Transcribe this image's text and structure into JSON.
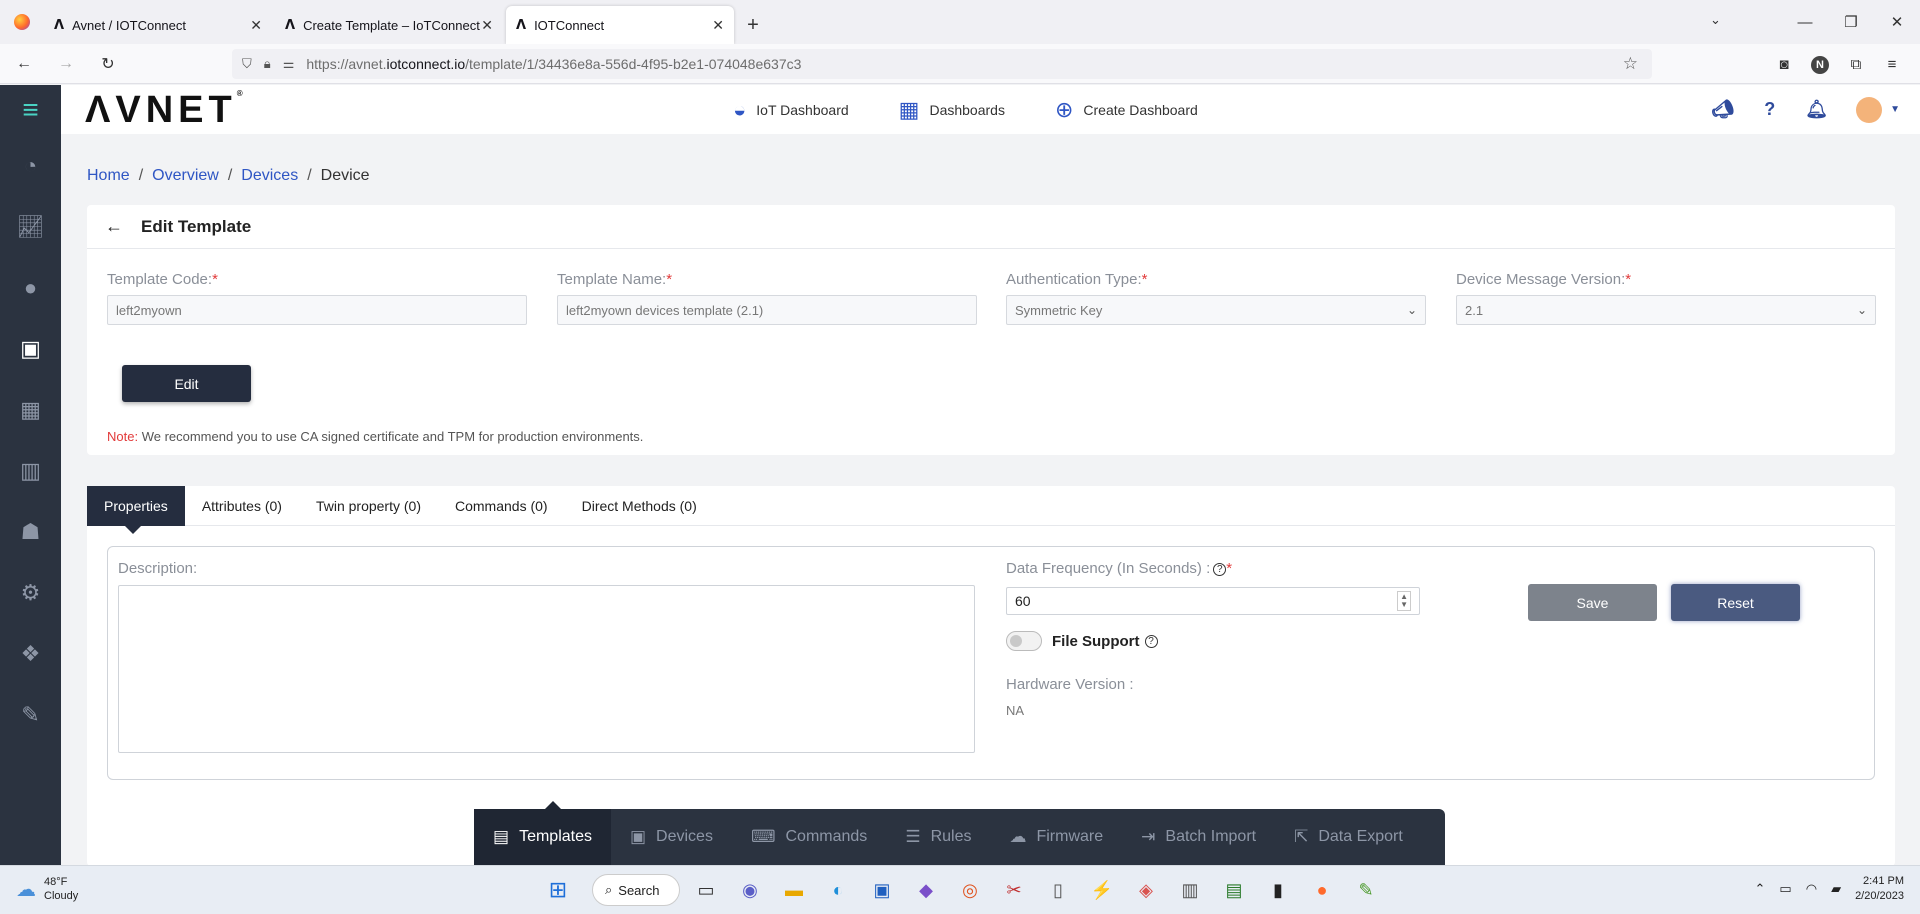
{
  "browser": {
    "tabs": [
      {
        "favicon": "Λ",
        "title": "Avnet / IOTConnect",
        "active": false
      },
      {
        "favicon": "Λ",
        "title": "Create Template – IoTConnect",
        "active": false
      },
      {
        "favicon": "Λ",
        "title": "IOTConnect",
        "active": true
      }
    ],
    "url_prefix": "https://avnet.",
    "url_domain": "iotconnect.io",
    "url_path": "/template/1/34436e8a-556d-4f95-b2e1-074048e637c3",
    "profile_initial": "N"
  },
  "header": {
    "logo": "ΛVNET",
    "logo_mark": "®",
    "nav": [
      {
        "label": "IoT Dashboard",
        "icon": "gauge-icon"
      },
      {
        "label": "Dashboards",
        "icon": "grid-icon"
      },
      {
        "label": "Create Dashboard",
        "icon": "plus-circle-icon"
      }
    ],
    "right_icons": [
      "megaphone-icon",
      "help-icon",
      "bell-icon",
      "avatar"
    ]
  },
  "breadcrumb": {
    "items": [
      "Home",
      "Overview",
      "Devices"
    ],
    "current": "Device",
    "separator": "/"
  },
  "template": {
    "title": "Edit Template",
    "fields": {
      "code_label": "Template Code:",
      "code_value": "left2myown",
      "name_label": "Template Name:",
      "name_value": "left2myown devices template (2.1)",
      "auth_label": "Authentication Type:",
      "auth_value": "Symmetric Key",
      "version_label": "Device Message Version:",
      "version_value": "2.1",
      "required_mark": "*"
    },
    "edit_label": "Edit",
    "note_label": "Note:",
    "note_text": " We recommend you to use CA signed certificate and TPM for production environments."
  },
  "properties": {
    "tabs": [
      "Properties",
      "Attributes (0)",
      "Twin property (0)",
      "Commands (0)",
      "Direct Methods (0)"
    ],
    "description_label": "Description:",
    "description_value": "",
    "frequency_label": "Data Frequency (In Seconds) :",
    "frequency_value": "60",
    "file_support_label": "File Support",
    "file_support_on": false,
    "hw_label": "Hardware Version :",
    "hw_value": "NA",
    "save_label": "Save",
    "reset_label": "Reset",
    "help_glyph": "?"
  },
  "bottom_bar": [
    {
      "label": "Templates",
      "icon": "template-icon",
      "active": true
    },
    {
      "label": "Devices",
      "icon": "chip-icon",
      "active": false
    },
    {
      "label": "Commands",
      "icon": "code-window-icon",
      "active": false
    },
    {
      "label": "Rules",
      "icon": "list-icon",
      "active": false
    },
    {
      "label": "Firmware",
      "icon": "cloud-icon",
      "active": false
    },
    {
      "label": "Batch Import",
      "icon": "import-icon",
      "active": false
    },
    {
      "label": "Data Export",
      "icon": "export-icon",
      "active": false
    }
  ],
  "taskbar": {
    "temp": "48°F",
    "weather": "Cloudy",
    "search_label": "Search",
    "time": "2:41 PM",
    "date": "2/20/2023"
  },
  "colors": {
    "sidebar": "#2b3340",
    "primary_button": "#252d3f",
    "reset_button": "#4a5a80",
    "link": "#2f56c4",
    "required": "#e23a3a"
  }
}
